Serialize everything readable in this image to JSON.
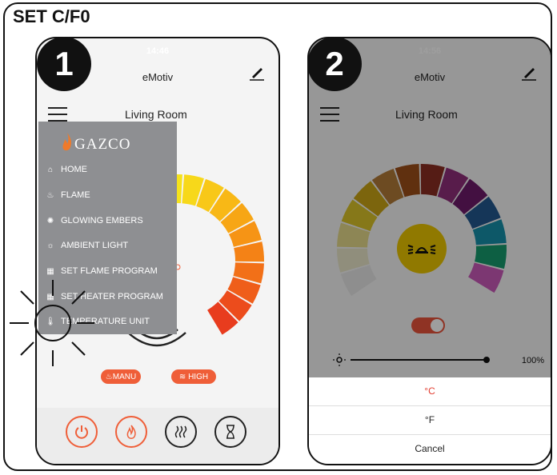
{
  "frame_title": "SET C/F0",
  "badges": [
    "1",
    "2"
  ],
  "phone1": {
    "status_time": "14:46",
    "app_title": "eMotiv",
    "room": "Living Room",
    "logo_text": "GAZCO",
    "menu_items": [
      {
        "icon": "home-icon",
        "label": "HOME"
      },
      {
        "icon": "flame-icon",
        "label": "FLAME"
      },
      {
        "icon": "glowing-embers-icon",
        "label": "GLOWING EMBERS"
      },
      {
        "icon": "ambient-light-icon",
        "label": "AMBIENT LIGHT"
      },
      {
        "icon": "calendar-icon",
        "label": "SET FLAME PROGRAM"
      },
      {
        "icon": "calendar-icon",
        "label": "SET HEATER PROGRAM"
      },
      {
        "icon": "thermometer-icon",
        "label": "TEMPERATURE UNIT"
      }
    ],
    "mode_manual": "MANU",
    "mode_high": "HIGH",
    "accent_color": "#ef5e38",
    "bottom_buttons": [
      {
        "icon": "power-icon"
      },
      {
        "icon": "flame-icon"
      },
      {
        "icon": "heat-icon"
      },
      {
        "icon": "hourglass-icon"
      }
    ]
  },
  "phone2": {
    "status_time": "14:56",
    "app_title": "eMotiv",
    "room": "Living Room",
    "brightness": "100%",
    "brightness_level": 1.0,
    "toggle_on": true,
    "sheet_options": [
      "°C",
      "°F",
      "Cancel"
    ],
    "selected_option": "°C",
    "selected_color": "#e23b2e"
  }
}
